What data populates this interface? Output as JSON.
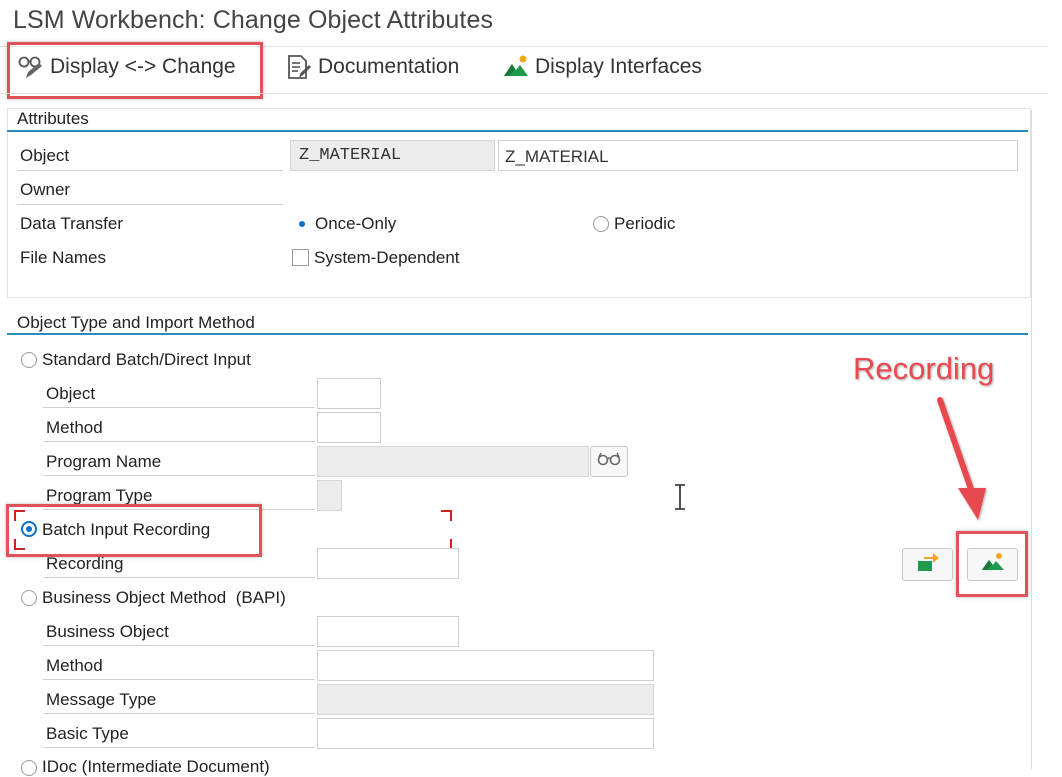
{
  "window": {
    "title": "LSM Workbench: Change Object Attributes"
  },
  "toolbar": {
    "display_change_label": "Display <-> Change",
    "documentation_label": "Documentation",
    "display_interfaces_label": "Display Interfaces"
  },
  "attributes": {
    "title": "Attributes",
    "object_label": "Object",
    "object_value": "Z_MATERIAL",
    "object_description": "Z_MATERIAL",
    "owner_label": "Owner",
    "data_transfer_label": "Data Transfer",
    "once_only_label": "Once-Only",
    "periodic_label": "Periodic",
    "data_transfer_selected": "Once-Only",
    "file_names_label": "File Names",
    "system_dependent_label": "System-Dependent",
    "system_dependent_checked": false
  },
  "import_method": {
    "title": "Object Type and Import Method",
    "standard_label": "Standard Batch/Direct Input",
    "std_object_label": "Object",
    "std_method_label": "Method",
    "program_name_label": "Program Name",
    "program_type_label": "Program Type",
    "batch_input_label": "Batch Input Recording",
    "recording_label": "Recording",
    "bapi_label": "Business Object Method  (BAPI)",
    "business_object_label": "Business Object",
    "bapi_method_label": "Method",
    "message_type_label": "Message Type",
    "basic_type_label": "Basic Type",
    "idoc_label": "IDoc (Intermediate Document)",
    "selected": "Batch Input Recording"
  },
  "annotation": {
    "recording_callout": "Recording"
  },
  "icons": {
    "display_change": "glasses-pencil-icon",
    "documentation": "document-pencil-icon",
    "display_interfaces": "mountain-icon",
    "search_help": "glasses-icon",
    "transfer": "arrow-transfer-icon",
    "recording": "mountain-icon"
  },
  "colors": {
    "accent": "#0a72c9",
    "annotation": "#e84a4f",
    "group_rule": "#2d8ac0"
  }
}
